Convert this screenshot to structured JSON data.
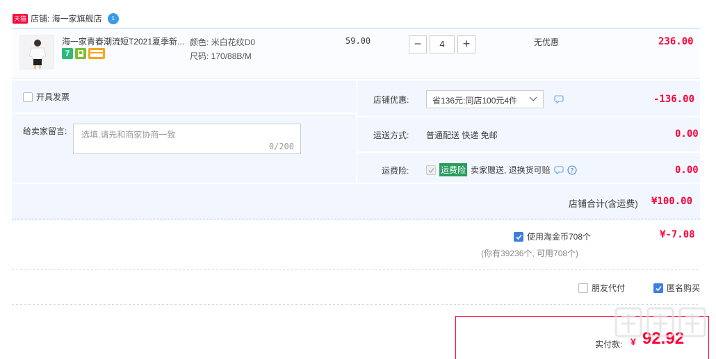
{
  "store": {
    "tag": "天猫",
    "label": "店铺: 海一家旗舰店",
    "wangwang_badge": "1"
  },
  "item": {
    "title": "海一家青春潮流短T2021夏季新...",
    "badge_seven": "7",
    "color_label": "颜色: 米白花纹D0",
    "size_label": "尺码: 170/88B/M",
    "unit_price": "59.00",
    "quantity": "4",
    "minus": "−",
    "plus": "+",
    "discount": "无优惠",
    "subtotal": "236.00"
  },
  "invoice": {
    "label": "开具发票",
    "checked": false
  },
  "message": {
    "label": "给卖家留言:",
    "placeholder": "选填,请先和商家协商一致",
    "counter": "0/200"
  },
  "promo": {
    "label": "店铺优惠:",
    "selected": "省136元:同店100元4件",
    "amount": "-136.00"
  },
  "shipping": {
    "label": "运送方式:",
    "value": "普通配送 快递 免邮",
    "amount": "0.00"
  },
  "insurance": {
    "label": "运费险:",
    "tag": "运费险",
    "desc": "卖家赠送, 退换货可赔",
    "amount": "0.00"
  },
  "store_total": {
    "label": "店铺合计(含运费)",
    "amount": "¥100.00"
  },
  "coins": {
    "label": "使用淘金币708个",
    "note": "(你有39236个, 可用708个)",
    "amount": "¥-7.08",
    "checked": true
  },
  "options": {
    "friend_pay": "朋友代付",
    "anonymous": "匿名购买",
    "anonymous_checked": true
  },
  "payment": {
    "label": "实付款:",
    "currency": "¥",
    "amount": "92.92"
  },
  "watermark": "值 什么值得买"
}
